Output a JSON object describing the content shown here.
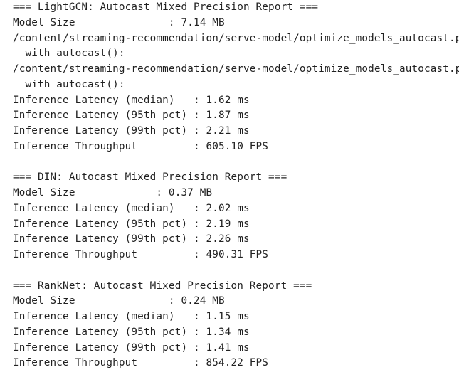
{
  "output_lines": [
    "=== LightGCN: Autocast Mixed Precision Report ===",
    "Model Size               : 7.14 MB",
    "/content/streaming-recommendation/serve-model/optimize_models_autocast.py",
    "  with autocast():",
    "/content/streaming-recommendation/serve-model/optimize_models_autocast.py",
    "  with autocast():",
    "Inference Latency (median)   : 1.62 ms",
    "Inference Latency (95th pct) : 1.87 ms",
    "Inference Latency (99th pct) : 2.21 ms",
    "Inference Throughput         : 605.10 FPS",
    "",
    "=== DIN: Autocast Mixed Precision Report ===",
    "Model Size             : 0.37 MB",
    "Inference Latency (median)   : 2.02 ms",
    "Inference Latency (95th pct) : 2.19 ms",
    "Inference Latency (99th pct) : 2.26 ms",
    "Inference Throughput         : 490.31 FPS",
    "",
    "=== RankNet: Autocast Mixed Precision Report ===",
    "Model Size               : 0.24 MB",
    "Inference Latency (median)   : 1.15 ms",
    "Inference Latency (95th pct) : 1.34 ms",
    "Inference Latency (99th pct) : 1.41 ms",
    "Inference Throughput         : 854.22 FPS"
  ]
}
